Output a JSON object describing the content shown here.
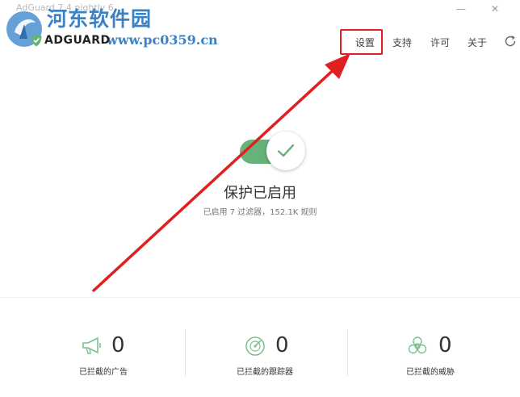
{
  "window": {
    "title": "AdGuard 7.4 nightly 6",
    "minimize_glyph": "—",
    "close_glyph": "✕"
  },
  "watermark": {
    "title": "河东软件园",
    "url": "www.pc0359.cn"
  },
  "brand": {
    "name": "ADGUARD"
  },
  "nav": {
    "settings": "设置",
    "support": "支持",
    "license": "许可",
    "about": "关于"
  },
  "protection": {
    "enabled": true,
    "title": "保护已启用",
    "subtitle": "已启用 7 过滤器，152.1K 规则"
  },
  "stats": [
    {
      "icon": "megaphone-icon",
      "value": "0",
      "label": "已拦截的广告"
    },
    {
      "icon": "radar-icon",
      "value": "0",
      "label": "已拦截的跟踪器"
    },
    {
      "icon": "biohazard-icon",
      "value": "0",
      "label": "已拦截的威胁"
    }
  ],
  "colors": {
    "accent": "#67b279",
    "watermark": "#3a82c6",
    "annotation": "#e02020",
    "stat_icon": "#7dc08f"
  }
}
